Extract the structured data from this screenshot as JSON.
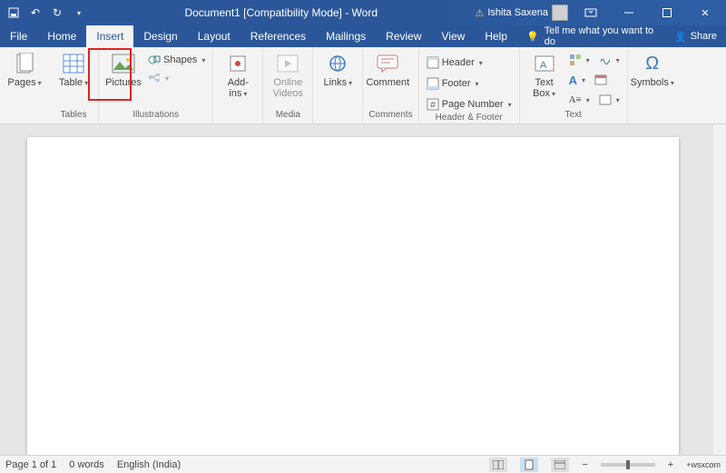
{
  "title": "Document1 [Compatibility Mode] - Word",
  "user": "Ishita Saxena",
  "menubar": {
    "file": "File",
    "home": "Home",
    "insert": "Insert",
    "design": "Design",
    "layout": "Layout",
    "references": "References",
    "mailings": "Mailings",
    "review": "Review",
    "view": "View",
    "help": "Help",
    "tell": "Tell me what you want to do",
    "share": "Share"
  },
  "ribbon": {
    "pages": {
      "label": "Pages",
      "group": "Tables"
    },
    "table": {
      "label": "Table",
      "group": "Tables"
    },
    "pictures": {
      "label": "Pictures"
    },
    "shapes": {
      "label": "Shapes"
    },
    "illustrations": "Illustrations",
    "addins": {
      "label": "Add-\nins",
      "group": ""
    },
    "online_videos": {
      "label": "Online\nVideos",
      "group": "Media"
    },
    "links": {
      "label": "Links",
      "group": ""
    },
    "comment": {
      "label": "Comment",
      "group": "Comments"
    },
    "header": {
      "label": "Header"
    },
    "footer": {
      "label": "Footer"
    },
    "page_number": {
      "label": "Page Number"
    },
    "header_footer_group": "Header & Footer",
    "text_box": {
      "label": "Text\nBox"
    },
    "text_group": "Text",
    "symbols": {
      "label": "Symbols",
      "group": ""
    }
  },
  "status": {
    "page": "Page 1 of 1",
    "words": "0 words",
    "lang": "English (India)",
    "zoom": "+wsxcom"
  }
}
